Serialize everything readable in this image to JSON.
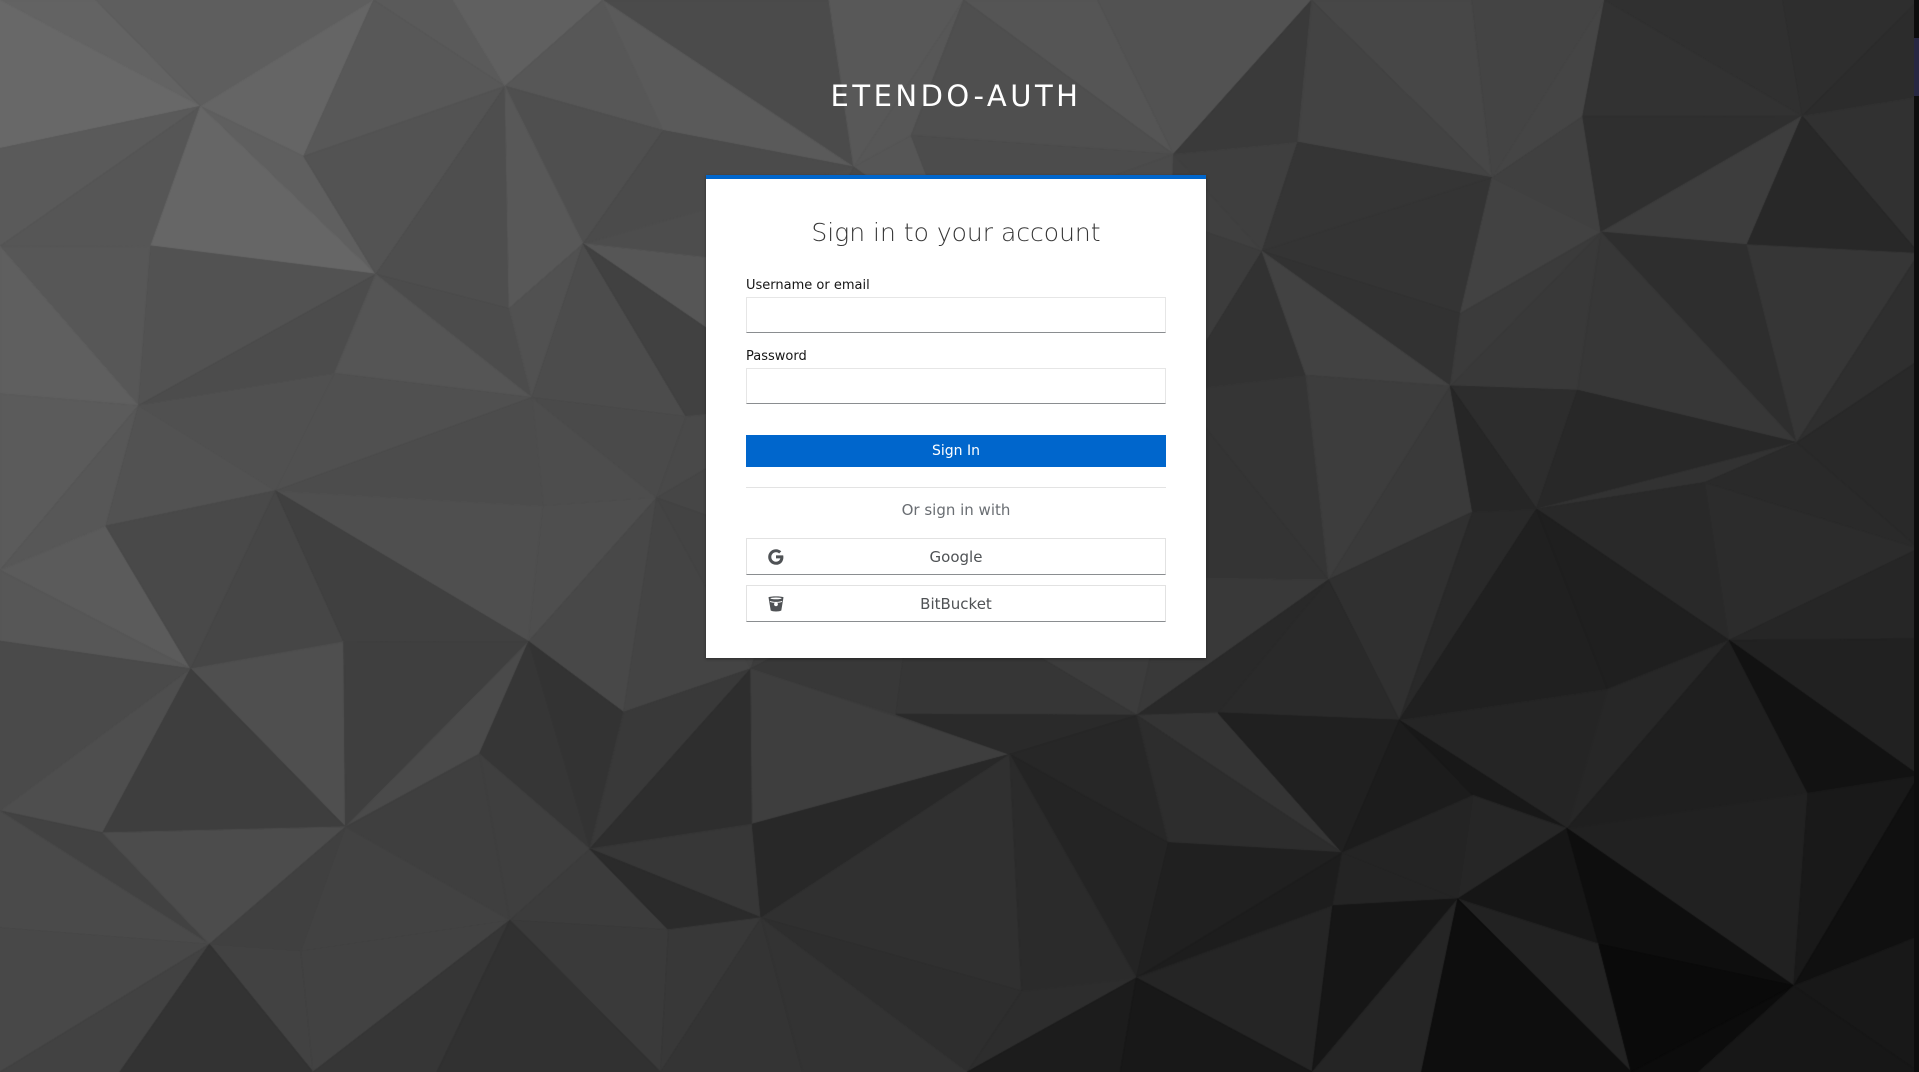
{
  "app": {
    "brand_title": "ETENDO-AUTH"
  },
  "login": {
    "heading": "Sign in to your account",
    "username_label": "Username or email",
    "username_value": "",
    "password_label": "Password",
    "password_value": "",
    "submit_label": "Sign In",
    "alt_login_text": "Or sign in with",
    "providers": [
      {
        "label": "Google",
        "icon": "google-icon"
      },
      {
        "label": "BitBucket",
        "icon": "bitbucket-icon"
      }
    ]
  },
  "colors": {
    "accent": "#0066cc",
    "card_background": "#ffffff",
    "page_background": "#2b2b2b"
  }
}
